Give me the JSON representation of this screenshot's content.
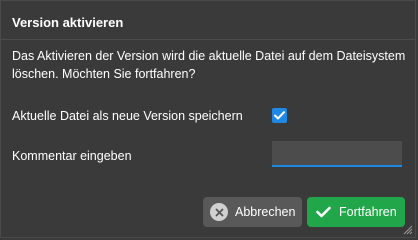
{
  "dialog": {
    "title": "Version aktivieren",
    "message": "Das Aktivieren der Version wird die aktuelle Datei auf dem Dateisystem löschen. Möchten Sie fortfahren?",
    "save_as_version_label": "Aktuelle Datei als neue Version speichern",
    "save_as_version_checked": true,
    "comment_label": "Kommentar eingeben",
    "comment_value": "",
    "cancel_label": "Abbrechen",
    "confirm_label": "Fortfahren"
  },
  "icons": {
    "checkbox": "checkmark-icon",
    "cancel": "close-icon",
    "confirm": "checkmark-icon",
    "resize": "resize-grip-icon"
  },
  "colors": {
    "background": "#3a3a3a",
    "accent": "#1e88e5",
    "confirm": "#21a64a",
    "cancel": "#595959"
  }
}
